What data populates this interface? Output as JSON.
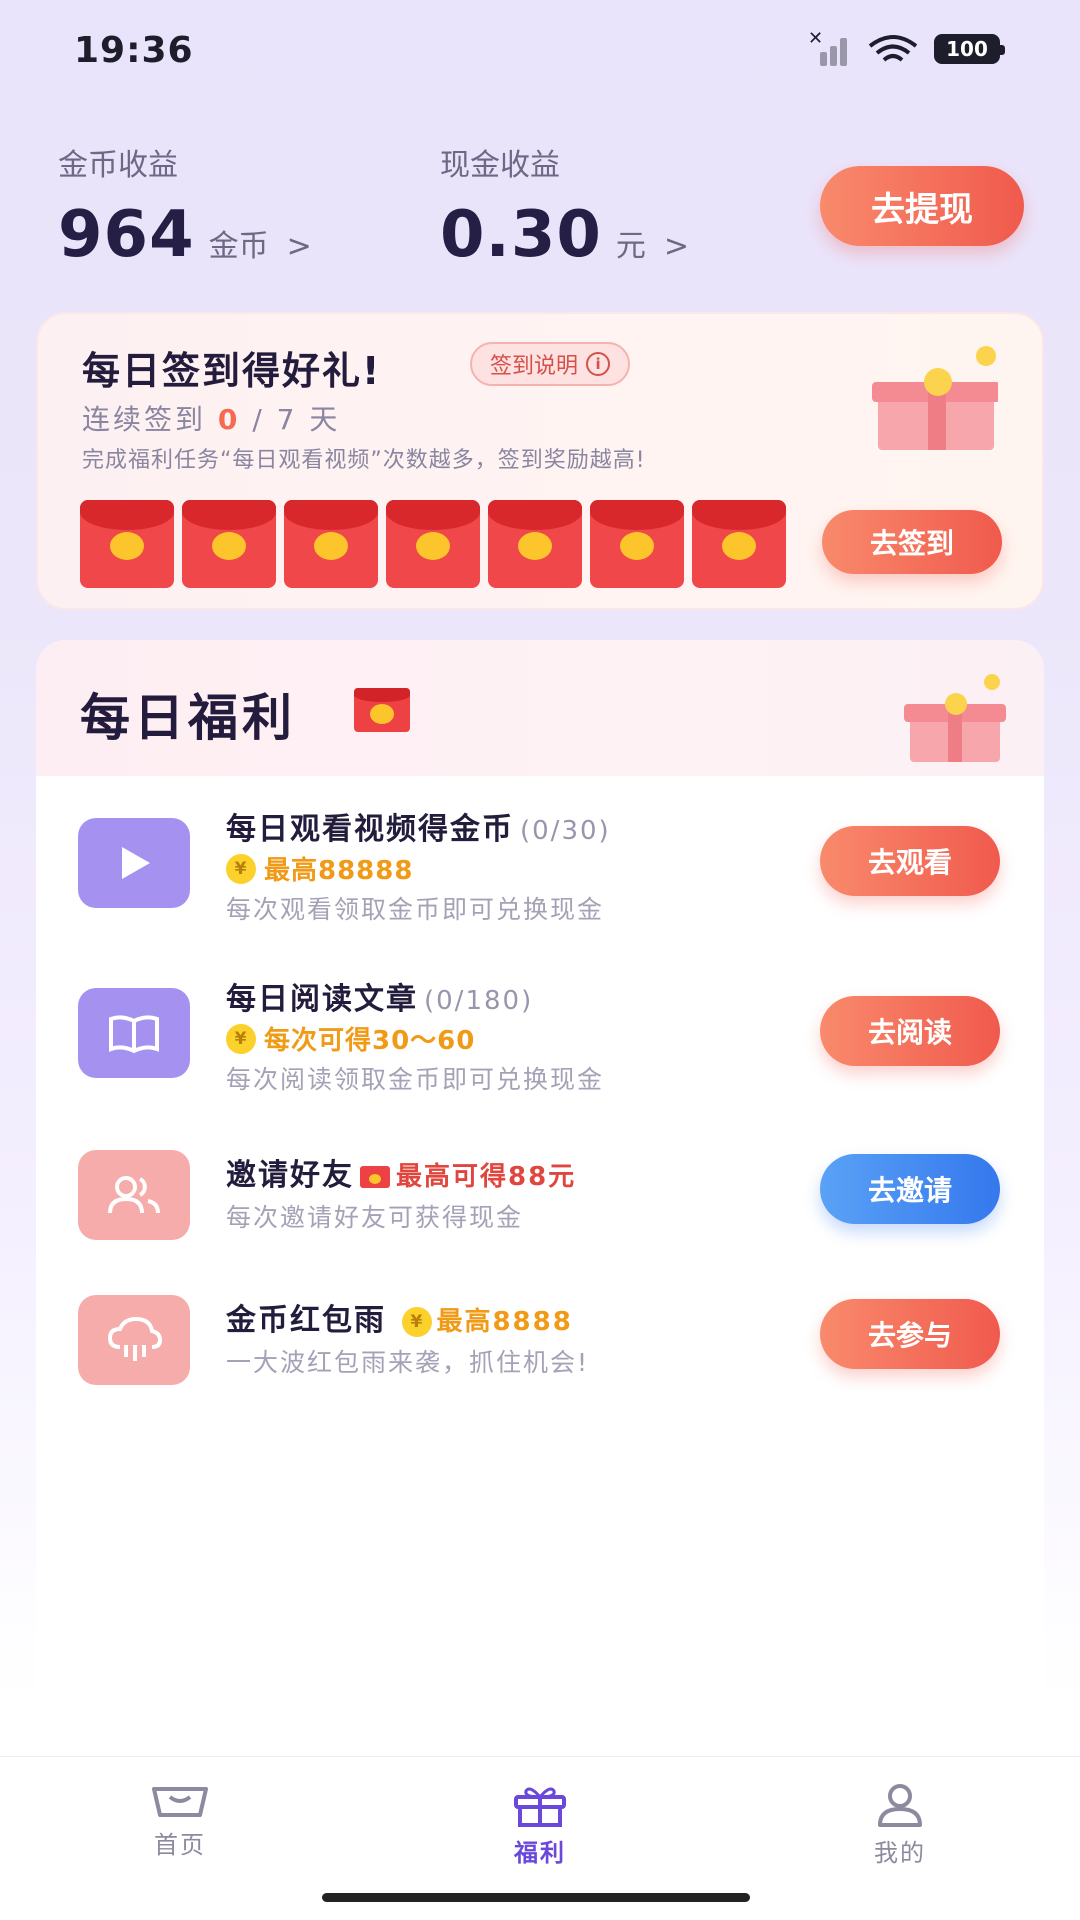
{
  "status_bar": {
    "time": "19:36",
    "battery": "100"
  },
  "earnings": {
    "coin": {
      "label": "金币收益",
      "value": "964",
      "unit": "金币",
      "arrow": ">"
    },
    "cash": {
      "label": "现金收益",
      "value": "0.30",
      "unit": "元",
      "arrow": ">"
    },
    "withdraw_label": "去提现"
  },
  "signin": {
    "title": "每日签到得好礼!",
    "help_label": "签到说明",
    "streak_prefix": "连续签到",
    "streak_count": "0",
    "streak_suffix": "/ 7 天",
    "description": "完成福利任务“每日观看视频”次数越多，签到奖励越高!",
    "days": 7,
    "button_label": "去签到"
  },
  "welfare": {
    "title": "每日福利",
    "tasks": [
      {
        "title": "每日观看视频得金币",
        "progress": "(0/30)",
        "reward": "最高88888",
        "desc": "每次观看领取金币即可兑换现金",
        "button": "去观看",
        "icon": "play-icon"
      },
      {
        "title": "每日阅读文章",
        "progress": "(0/180)",
        "reward": "每次可得30～60",
        "desc": "每次阅读领取金币即可兑换现金",
        "button": "去阅读",
        "icon": "book-icon"
      },
      {
        "title": "邀请好友",
        "reward": "最高可得88元",
        "desc": "每次邀请好友可获得现金",
        "button": "去邀请",
        "icon": "friends-icon"
      },
      {
        "title": "金币红包雨",
        "reward": "最高8888",
        "desc": "一大波红包雨来袭，抓住机会!",
        "button": "去参与",
        "icon": "rain-cloud-icon"
      }
    ]
  },
  "nav": {
    "items": [
      {
        "label": "首页",
        "icon": "home-icon"
      },
      {
        "label": "福利",
        "icon": "gift-icon",
        "active": true
      },
      {
        "label": "我的",
        "icon": "user-icon"
      }
    ]
  },
  "colors": {
    "accent": "#f05a4d",
    "active_nav": "#6a48d9",
    "reward": "#f09a16"
  }
}
